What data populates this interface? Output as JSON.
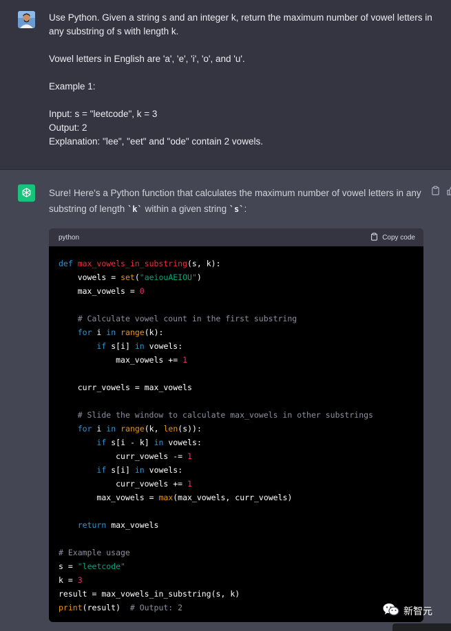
{
  "user_message": {
    "lines": [
      "Use Python. Given a string s and an integer k, return the maximum number of vowel letters in",
      "any substring of s with length k.",
      "",
      "Vowel letters in English are 'a', 'e', 'i', 'o', and 'u'.",
      "",
      "Example 1:",
      "",
      "Input: s = \"leetcode\", k = 3",
      "Output: 2",
      "Explanation: \"lee\", \"eet\" and \"ode\" contain 2 vowels."
    ]
  },
  "assistant_message": {
    "intro_part1": "Sure! Here's a Python function that calculates the maximum number of vowel letters in any substring of length ",
    "intro_code1": "`k`",
    "intro_part2": " within a given string ",
    "intro_code2": "`s`",
    "intro_part3": ":",
    "code_block": {
      "language": "python",
      "copy_label": "Copy code",
      "lines": [
        "def max_vowels_in_substring(s, k):",
        "    vowels = set(\"aeiouAEIOU\")",
        "    max_vowels = 0",
        "",
        "    # Calculate vowel count in the first substring",
        "    for i in range(k):",
        "        if s[i] in vowels:",
        "            max_vowels += 1",
        "",
        "    curr_vowels = max_vowels",
        "",
        "    # Slide the window to calculate max_vowels in other substrings",
        "    for i in range(k, len(s)):",
        "        if s[i - k] in vowels:",
        "            curr_vowels -= 1",
        "        if s[i] in vowels:",
        "            curr_vowels += 1",
        "        max_vowels = max(max_vowels, curr_vowels)",
        "",
        "    return max_vowels",
        "",
        "# Example usage",
        "s = \"leetcode\"",
        "k = 3",
        "result = max_vowels_in_substring(s, k)",
        "print(result)  # Output: 2"
      ]
    }
  },
  "watermark": {
    "text": "新智元"
  },
  "icons": {
    "user_avatar": "user-avatar",
    "assistant_logo": "openai-logo-icon",
    "copy_message": "clipboard-icon",
    "thumbs_up": "thumbs-up-icon",
    "copy_code": "clipboard-icon",
    "watermark": "wechat-icon"
  },
  "colors": {
    "user_bg": "#343541",
    "assistant_bg": "#444654",
    "code_bg": "#000000",
    "code_header_bg": "#343541",
    "openai_green": "#19c37d",
    "keyword": "#2e95d3",
    "function": "#f22c3d",
    "string": "#00a67d",
    "number": "#df3079",
    "comment": "#8e8ea0",
    "builtin": "#e9950c"
  }
}
